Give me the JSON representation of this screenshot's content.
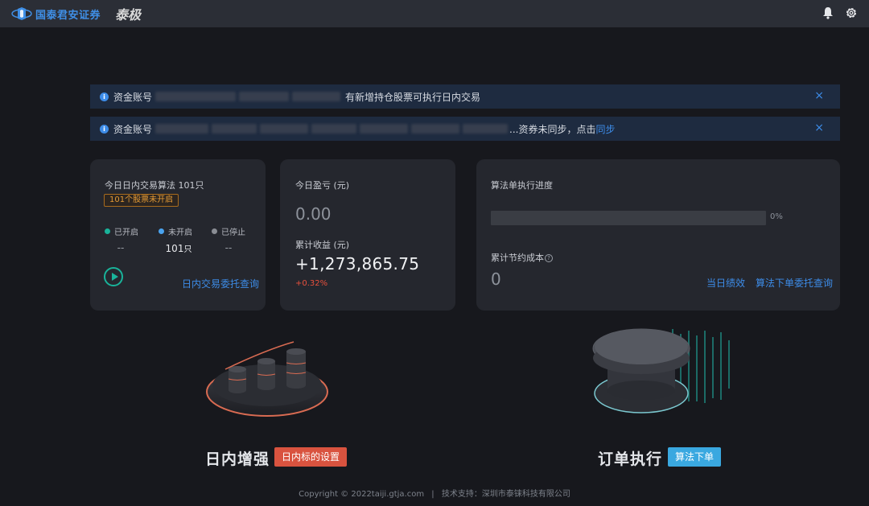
{
  "header": {
    "brand_name": "国泰君安证券",
    "product_name": "泰极"
  },
  "alerts": [
    {
      "prefix": "资金账号",
      "message": "有新增持仓股票可执行日内交易",
      "link": "",
      "close": "×"
    },
    {
      "prefix": "资金账号",
      "message": "...资券未同步，点击",
      "link": "同步",
      "close": "×"
    }
  ],
  "algo_card": {
    "title": "今日日内交易算法 101只",
    "tag": "101个股票未开启",
    "statuses": [
      {
        "label": "已开启",
        "value": "--",
        "color": "#19b39a"
      },
      {
        "label": "未开启",
        "value": "101",
        "unit": "只",
        "color": "#4aa3ef"
      },
      {
        "label": "已停止",
        "value": "--",
        "color": "#8a8d94"
      }
    ],
    "link": "日内交易委托查询"
  },
  "pnl_card": {
    "today_label": "今日盈亏 (元)",
    "today_value": "0.00",
    "total_label": "累计收益 (元)",
    "total_value": "+1,273,865.75",
    "total_pct": "+0.32%"
  },
  "progress_card": {
    "title": "算法单执行进度",
    "progress_percent_text": "0%",
    "progress_value": 0,
    "saving_label": "累计节约成本",
    "saving_value": "0",
    "link_performance": "当日绩效",
    "link_orders": "算法下单委托查询"
  },
  "features": [
    {
      "title": "日内增强",
      "button": "日内标的设置",
      "button_color": "#d9533f"
    },
    {
      "title": "订单执行",
      "button": "算法下单",
      "button_color": "#3aa8e0"
    }
  ],
  "footer": {
    "copyright": "Copyright © 2022taiji.gtja.com",
    "support": "技术支持：深圳市泰铼科技有限公司"
  }
}
